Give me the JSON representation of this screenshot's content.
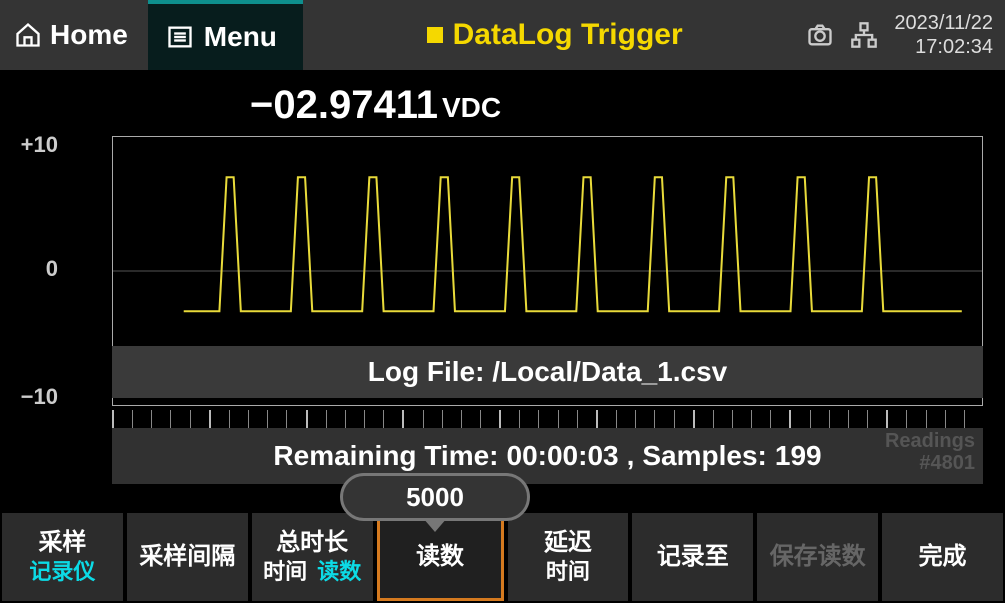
{
  "topbar": {
    "home": "Home",
    "menu": "Menu",
    "title": "DataLog Trigger",
    "date": "2023/11/22",
    "time": "17:02:34"
  },
  "reading": {
    "value": "−02.97411",
    "unit": "VDC"
  },
  "chart_data": {
    "type": "line",
    "title": "",
    "xlabel": "",
    "ylabel": "",
    "ylim": [
      -10,
      10
    ],
    "yticks": [
      -10,
      0,
      10
    ],
    "x": [
      0,
      1,
      2,
      3,
      4,
      5,
      6,
      7,
      8,
      9,
      10,
      11,
      12,
      13,
      14,
      15,
      16,
      17,
      18,
      19,
      20,
      21,
      22,
      23,
      24,
      25,
      26,
      27,
      28,
      29,
      30,
      31,
      32,
      33,
      34,
      35,
      36,
      37,
      38,
      39,
      40,
      41,
      42,
      43,
      44,
      45,
      46,
      47,
      48,
      49,
      50,
      51,
      52,
      53,
      54,
      55,
      56,
      57,
      58,
      59,
      60,
      61,
      62,
      63,
      64,
      65,
      66,
      67,
      68,
      69,
      70,
      71,
      72,
      73,
      74,
      75,
      76,
      77,
      78,
      79,
      80,
      81,
      82,
      83,
      84,
      85,
      86,
      87,
      88,
      89,
      90,
      91,
      92,
      93,
      94,
      95,
      96,
      97,
      98,
      99,
      100,
      101,
      102,
      103,
      104,
      105,
      106,
      107,
      108,
      109
    ],
    "y": [
      -3,
      -3,
      -3,
      -3,
      -3,
      -3,
      7,
      7,
      -3,
      -3,
      -3,
      -3,
      -3,
      -3,
      -3,
      -3,
      7,
      7,
      -3,
      -3,
      -3,
      -3,
      -3,
      -3,
      -3,
      -3,
      7,
      7,
      -3,
      -3,
      -3,
      -3,
      -3,
      -3,
      -3,
      -3,
      7,
      7,
      -3,
      -3,
      -3,
      -3,
      -3,
      -3,
      -3,
      -3,
      7,
      7,
      -3,
      -3,
      -3,
      -3,
      -3,
      -3,
      -3,
      -3,
      7,
      7,
      -3,
      -3,
      -3,
      -3,
      -3,
      -3,
      -3,
      -3,
      7,
      7,
      -3,
      -3,
      -3,
      -3,
      -3,
      -3,
      -3,
      -3,
      7,
      7,
      -3,
      -3,
      -3,
      -3,
      -3,
      -3,
      -3,
      -3,
      7,
      7,
      -3,
      -3,
      -3,
      -3,
      -3,
      -3,
      -3,
      -3,
      7,
      7,
      -3,
      -3,
      -3,
      -3,
      -3,
      -3,
      -3,
      -3,
      -3,
      -3,
      -3,
      -3
    ]
  },
  "overlay": {
    "file_label": "Log File:",
    "file_path": "/Local/Data_1.csv",
    "remaining_label": "Remaining Time:",
    "remaining_value": "00:00:03",
    "samples_label": "Samples:",
    "samples_value": "199",
    "readings_label": "Readings",
    "readings_count": "#4801",
    "bubble_value": "5000"
  },
  "softkeys": [
    {
      "line1": "采样",
      "line2": "记录仪",
      "line2_cyan": true
    },
    {
      "line1": "采样间隔"
    },
    {
      "line1": "总时长",
      "line2_double": true,
      "line2a": "时间",
      "line2b": "读数"
    },
    {
      "line1": "读数",
      "active": true
    },
    {
      "line1": "延迟",
      "line2": "时间"
    },
    {
      "line1": "记录至"
    },
    {
      "line1": "保存读数",
      "disabled": true
    },
    {
      "line1": "完成"
    }
  ]
}
